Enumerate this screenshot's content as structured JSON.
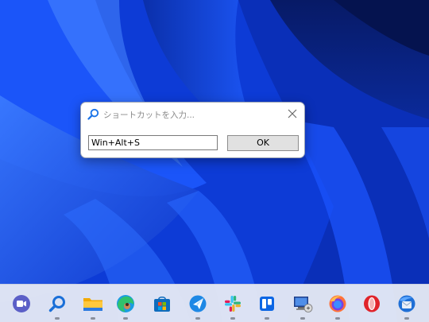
{
  "dialog": {
    "title": "ショートカットを入力...",
    "input_value": "Win+Alt+S",
    "ok_label": "OK"
  },
  "taskbar": {
    "items": [
      {
        "name": "teams-chat",
        "icon": "video-chat-icon",
        "running": false,
        "color": "#5b5fc7"
      },
      {
        "name": "search",
        "icon": "search-icon",
        "running": true,
        "color": "#1a6fd8"
      },
      {
        "name": "file-explorer",
        "icon": "folder-icon",
        "running": true,
        "color": "#f4b400"
      },
      {
        "name": "edge-app",
        "icon": "edge-icon",
        "running": true,
        "color": "#1d8f7a"
      },
      {
        "name": "microsoft-store",
        "icon": "store-icon",
        "running": false,
        "color": "#0f6cbd"
      },
      {
        "name": "quick-app",
        "icon": "paper-plane-icon",
        "running": true,
        "color": "#1e88e5"
      },
      {
        "name": "slack",
        "icon": "slack-icon",
        "running": true,
        "color": "#e01e5a"
      },
      {
        "name": "trello",
        "icon": "trello-icon",
        "running": true,
        "color": "#0c66e4"
      },
      {
        "name": "remote-desktop",
        "icon": "monitor-icon",
        "running": true,
        "color": "#2b5fb8"
      },
      {
        "name": "firefox",
        "icon": "firefox-icon",
        "running": true,
        "color": "#ff7139"
      },
      {
        "name": "opera",
        "icon": "opera-icon",
        "running": false,
        "color": "#e0242b"
      },
      {
        "name": "thunderbird",
        "icon": "thunderbird-icon",
        "running": true,
        "color": "#1f6fd6"
      }
    ]
  }
}
